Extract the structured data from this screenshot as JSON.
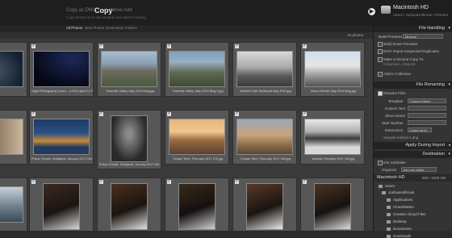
{
  "topbar": {
    "modes": [
      "Copy as DNG",
      "Copy",
      "Move",
      "Add"
    ],
    "subtitle": "Copy photos to a new location and add to catalog",
    "arrow_icon": "▶",
    "destination_name": "Macintosh HD",
    "destination_path": "Users / JoshuaHolbrook / Pictures"
  },
  "tabs": [
    "All Photos",
    "New Photos",
    "Destination Folders"
  ],
  "grid": {
    "photo_count": "34 photos",
    "row1_captions": [
      "",
      "Night Photography Cours... 4-2014.April 12 2016.jpg",
      "Yosemite Valley, May 2014 Blog.jpg",
      "Yosemite Valley, May 2014 Blog 2.jpg",
      "Warbird Cafe Redmond May 2016.jpg",
      "Mount Denali, May 2014 Blog.jpg"
    ],
    "row2_captions": [
      "",
      "Prison Temple, Budapest, January 2017 016.jpg",
      "Prison Temple, Budapest, January 2017 061.jpg",
      "Cinque Terre, February 2017 178.jpg",
      "Cinque Terre, February 2017 184.jpg",
      "Iceland, February 2017 206.jpg"
    ],
    "row3_captions": [
      "",
      "",
      "",
      "",
      "",
      ""
    ]
  },
  "colors": {
    "panel_header": "#232323",
    "grid_bg": "#3a3a3a",
    "cell_bg": "#575757"
  },
  "rail": {
    "file_handling": {
      "title": "File Handling",
      "build_previews_label": "Build Previews",
      "build_previews_value": "Minimal",
      "smart_previews": "Build Smart Previews",
      "dont_import": "Don't Import Suspected Duplicates",
      "second_copy": "Make a Second Copy To:",
      "second_copy_path": "/Volumes/.../Imports",
      "add_collection": "Add to Collection"
    },
    "file_renaming": {
      "title": "File Renaming",
      "rename_files": "Rename Files",
      "template_label": "Template",
      "template_value": "Custom Name",
      "custom_text_label": "Custom Text",
      "shoot_name_label": "Shoot Name",
      "start_number_label": "Start Number",
      "extensions_label": "Extensions",
      "extensions_value": "Leave as-is",
      "sample_label": "Sample",
      "sample_value": "untitled-1.dng"
    },
    "apply_during_import": {
      "title": "Apply During Import"
    },
    "destination": {
      "title": "Destination",
      "into_subfolder": "Into Subfolder",
      "organize_label": "Organize",
      "organize_value": "Into one folder"
    },
    "volume": {
      "name": "Macintosh HD",
      "info": "500 / 1000 GB"
    },
    "tree": [
      "Users",
      "JoshuaHolbrook",
      "Applications",
      "CloudStation",
      "Creative Cloud Files",
      "Desktop",
      "Documents",
      "Downloads"
    ]
  }
}
